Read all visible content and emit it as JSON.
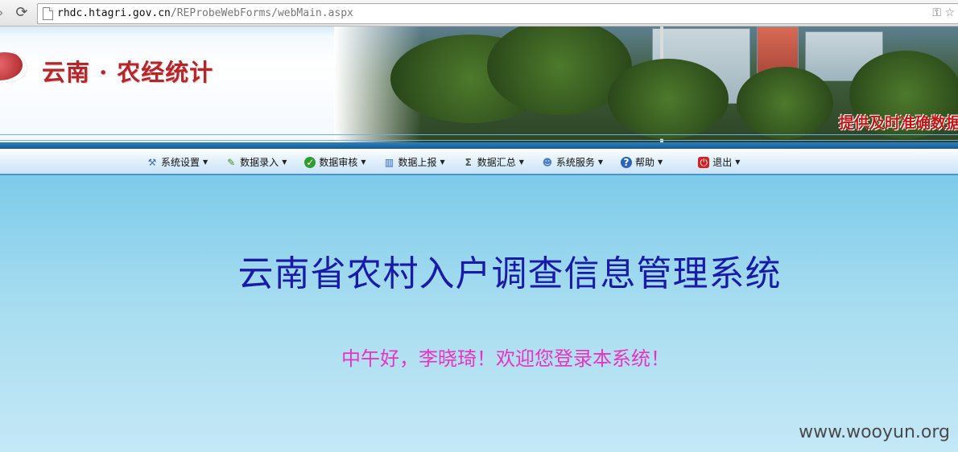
{
  "browser": {
    "url_host": "rhdc.htagri.gov.cn",
    "url_path": "/REProbeWebForms/webMain.aspx",
    "icons": [
      "back-arrow-icon",
      "reload-icon",
      "page-icon",
      "key-icon",
      "star-icon"
    ]
  },
  "banner": {
    "logo_text": "云南 · 农经统计",
    "slogan": "提供及时准确数据"
  },
  "menu": {
    "items": [
      {
        "label": "系统设置",
        "icon": "settings-icon"
      },
      {
        "label": "数据录入",
        "icon": "pencil-icon"
      },
      {
        "label": "数据审核",
        "icon": "check-icon"
      },
      {
        "label": "数据上报",
        "icon": "bar-chart-icon"
      },
      {
        "label": "数据汇总",
        "icon": "sigma-icon"
      },
      {
        "label": "系统服务",
        "icon": "user-icon"
      },
      {
        "label": "帮助",
        "icon": "help-icon"
      },
      {
        "label": "退出",
        "icon": "power-icon"
      }
    ]
  },
  "main": {
    "system_title": "云南省农村入户调查信息管理系统",
    "welcome": "中午好，李晓琦！欢迎您登录本系统！",
    "watermark": "www.wooyun.org"
  },
  "colors": {
    "title": "#1a1aa8",
    "welcome": "#e832c7",
    "logo": "#b3262a",
    "background": "#a6dcf0"
  }
}
